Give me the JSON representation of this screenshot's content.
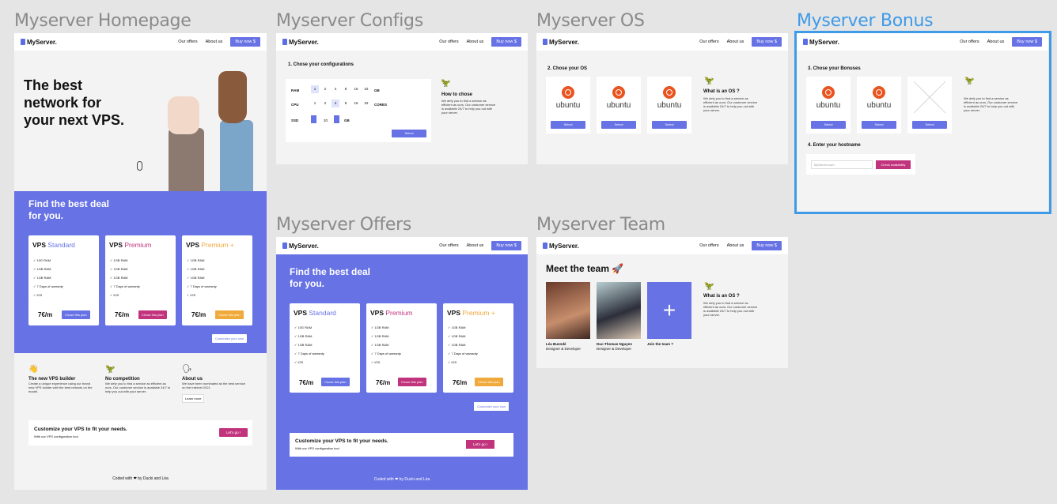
{
  "frames": {
    "home": "Myserver Homepage",
    "configs": "Myserver Configs",
    "os": "Myserver OS",
    "bonus": "Myserver Bonus",
    "offers": "Myserver Offers",
    "team": "Myserver Team"
  },
  "nav": {
    "logo": "MyServer.",
    "offers": "Our offers",
    "about": "About us",
    "buy": "Buy now $"
  },
  "hero": {
    "line1": "The best",
    "line2": "network for",
    "line3": "your next VPS."
  },
  "deal": {
    "line1": "Find the best deal",
    "line2": "for you."
  },
  "plans": [
    {
      "name": "VPS",
      "tier": "Standard",
      "color": "#6772e5",
      "features": [
        "10G RAM",
        "1GB RAM",
        "1GB RAM",
        "7 Days of warranty",
        "iOS"
      ],
      "price": "7€/m",
      "button": "Chose this plan",
      "btn_color": "#6772e5"
    },
    {
      "name": "VPS",
      "tier": "Premium",
      "color": "#c2337d",
      "features": [
        "1GB RAM",
        "1GB RAM",
        "1GB RAM",
        "7 Days of warranty",
        "iOS"
      ],
      "price": "7€/m",
      "button": "Chose this plan",
      "btn_color": "#c2337d"
    },
    {
      "name": "VPS",
      "tier": "Premium +",
      "color": "#f0a93b",
      "features": [
        "1GB RAM",
        "1GB RAM",
        "1GB RAM",
        "7 Days of warranty",
        "iOS"
      ],
      "price": "7€/m",
      "button": "Chose this plan",
      "btn_color": "#f0a93b"
    }
  ],
  "customize_own": "Customize your own",
  "features": [
    {
      "title": "The new VPS builder",
      "text": "Create a unique experience using our brand new VPS builder with the best network on the model."
    },
    {
      "title": "No competition",
      "text": "We defy you to find a service as efficient as ours. Our costumer service is available 24/7 to help you out with your server."
    },
    {
      "title": "About us",
      "text": "We have been nominated as the best service on the Internet 2021",
      "button": "Learn more"
    }
  ],
  "cta": {
    "title": "Customize your VPS to fit your needs.",
    "sub": "With our VPS configuration tool",
    "button": "Let's go !"
  },
  "footer": "Coded with ❤ by Ducki and Léa",
  "configs": {
    "heading": "1. Chose your configurations",
    "ram_label": "RAM",
    "ram_values": [
      "1",
      "2",
      "4",
      "8",
      "16",
      "32"
    ],
    "ram_unit": "GB",
    "cpu_label": "CPU",
    "cpu_values": [
      "1",
      "2",
      "4",
      "8",
      "16",
      "32"
    ],
    "cpu_unit": "CORES",
    "ssd_label": "SSD",
    "ssd_value": "20",
    "ssd_unit": "GB",
    "select": "Select",
    "how_title": "How to chose",
    "how_text": "We defy you to find a service as efficient as ours. Our costumer service is available 24/7 to help you out with your server."
  },
  "os": {
    "heading": "2. Chose your OS",
    "logo": "ubuntu",
    "select": "Select",
    "side_title": "What is an OS ?",
    "side_text": "We defy you to find a service as efficient as ours. Our costumer service is available 24/7 to help you out with your server."
  },
  "bonus": {
    "heading": "3. Chose your Bonuses",
    "heading2": "4. Enter your hostname",
    "placeholder": "MyServer.com",
    "check": "Check availability",
    "side_text": "We defy you to find a service as efficient as ours. Our costumer service is available 24/7 to help you out with your server."
  },
  "team": {
    "heading": "Meet the team 🚀",
    "members": [
      {
        "name": "Léa Buendé",
        "role": "Designer & Developer"
      },
      {
        "name": "Duc-Thomas Nguyen",
        "role": "Designer & Developer"
      }
    ],
    "join": "Join the team ?",
    "plus": "+",
    "side_title": "What is an OS ?",
    "side_text": "We defy you to find a service as efficient as ours. Our costumer service is available 24/7 to help you out with your server."
  }
}
